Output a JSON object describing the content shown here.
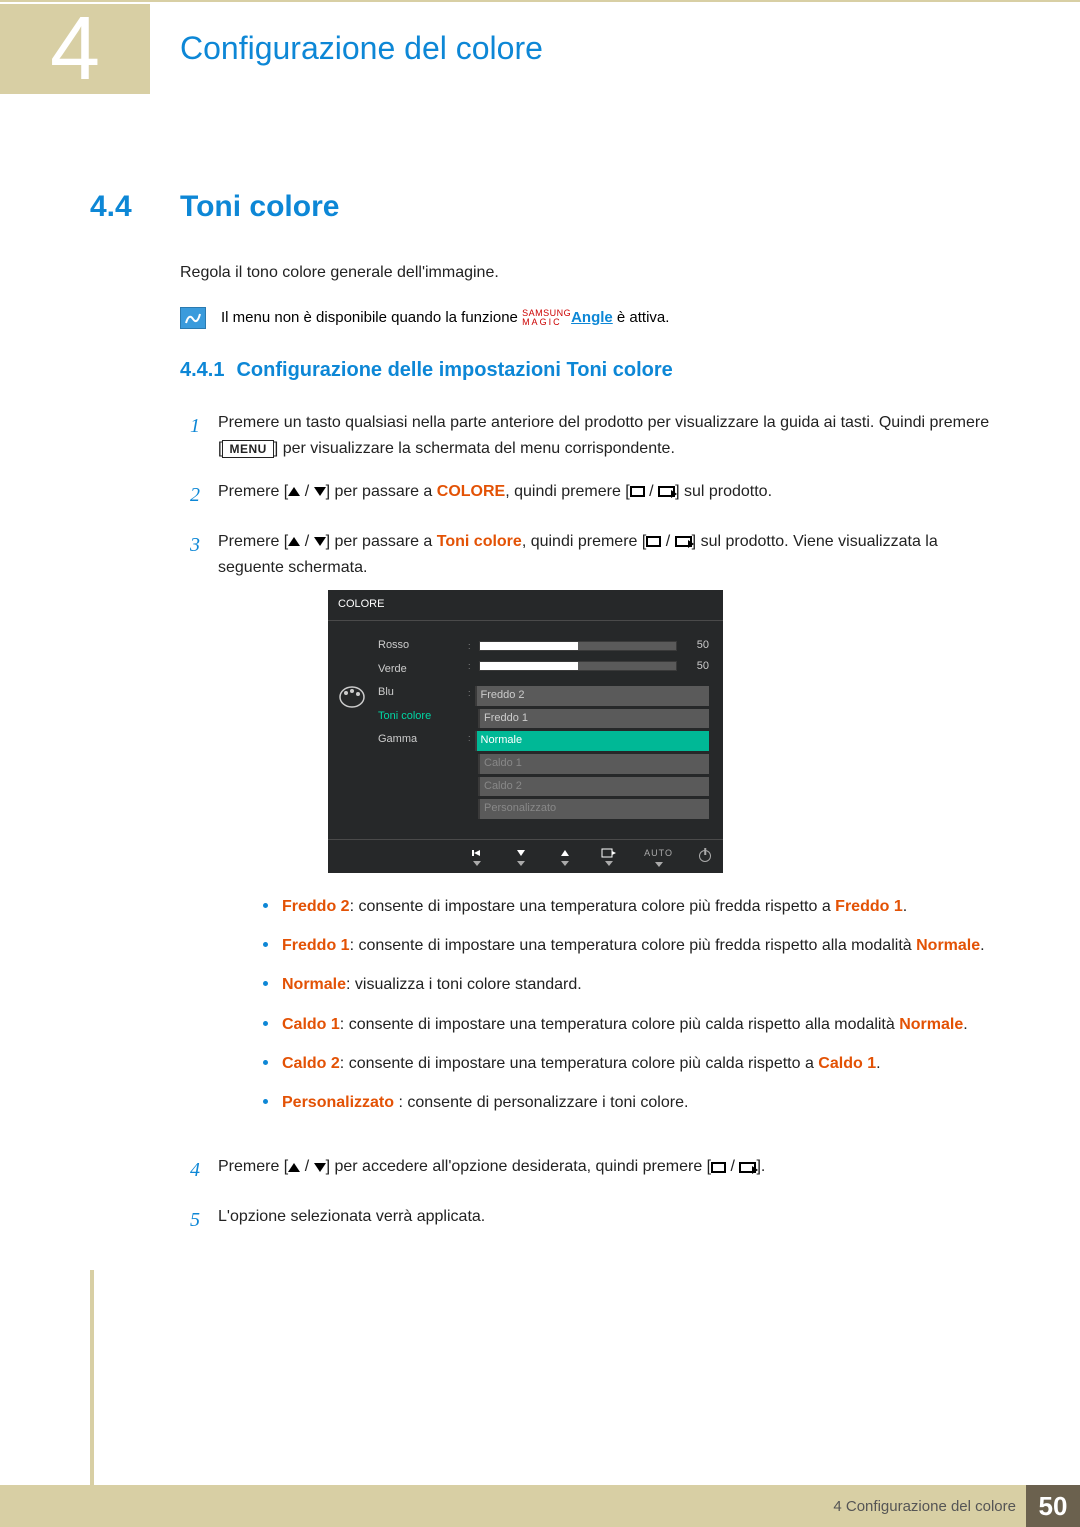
{
  "header": {
    "chapter_num": "4",
    "chapter_title": "Configurazione del colore"
  },
  "section": {
    "num": "4.4",
    "title": "Toni colore"
  },
  "intro": "Regola il tono colore generale dell'immagine.",
  "note": {
    "pre": "Il menu non è disponibile quando la funzione ",
    "samsung": "SAMSUNG",
    "magic": "MAGIC",
    "angle": "Angle",
    "post": " è attiva."
  },
  "subsection": {
    "num": "4.4.1",
    "title": "Configurazione delle impostazioni Toni colore"
  },
  "steps": {
    "s1": {
      "num": "1",
      "pre": "Premere un tasto qualsiasi nella parte anteriore del prodotto per visualizzare la guida ai tasti. Quindi premere [",
      "menu": "MENU",
      "post": "] per visualizzare la schermata del menu corrispondente."
    },
    "s2": {
      "num": "2",
      "pre": "Premere [",
      "mid": "] per passare a ",
      "colore": "COLORE",
      "mid2": ", quindi premere [",
      "post": "] sul prodotto."
    },
    "s3": {
      "num": "3",
      "pre": "Premere [",
      "mid": "] per passare a ",
      "toni": "Toni colore",
      "mid2": ", quindi premere [",
      "post": "] sul prodotto. Viene visualizzata la seguente schermata."
    },
    "s4": {
      "num": "4",
      "pre": "Premere [",
      "mid": "] per accedere all'opzione desiderata, quindi premere [",
      "post": "]."
    },
    "s5": {
      "num": "5",
      "text": "L'opzione selezionata verrà applicata."
    }
  },
  "osd": {
    "title": "COLORE",
    "menu": [
      "Rosso",
      "Verde",
      "Blu",
      "Toni colore",
      "Gamma"
    ],
    "active_index": 3,
    "sliders": [
      {
        "value": "50",
        "fill": 50
      },
      {
        "value": "50",
        "fill": 50
      }
    ],
    "dropdown": [
      "Freddo 2",
      "Freddo 1",
      "Normale",
      "Caldo 1",
      "Caldo 2",
      "Personalizzato"
    ],
    "selected_dd": 2,
    "auto": "AUTO"
  },
  "bullets": [
    {
      "kw": "Freddo 2",
      "text": ": consente di impostare una temperatura colore più fredda rispetto a ",
      "kw2": "Freddo 1",
      "tail": "."
    },
    {
      "kw": "Freddo 1",
      "text": ": consente di impostare una temperatura colore più fredda rispetto alla modalità ",
      "kw2": "Normale",
      "tail": "."
    },
    {
      "kw": "Normale",
      "text": ": visualizza i toni colore standard.",
      "kw2": "",
      "tail": ""
    },
    {
      "kw": "Caldo 1",
      "text": ": consente di impostare una temperatura colore più calda rispetto alla modalità ",
      "kw2": "Normale",
      "tail": "."
    },
    {
      "kw": "Caldo 2",
      "text": ": consente di impostare una temperatura colore più calda rispetto a ",
      "kw2": "Caldo 1",
      "tail": "."
    },
    {
      "kw": "Personalizzato ",
      "text": ": consente di personalizzare i toni colore.",
      "kw2": "",
      "tail": ""
    }
  ],
  "footer": {
    "text": "4 Configurazione del colore",
    "page": "50"
  }
}
